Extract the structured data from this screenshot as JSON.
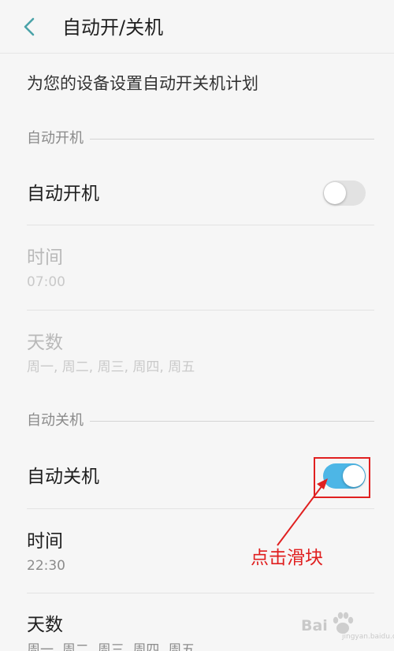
{
  "header": {
    "title": "自动开/关机"
  },
  "description": "为您的设备设置自动开关机计划",
  "power_on_section": {
    "label": "自动开机",
    "toggle": {
      "label": "自动开机",
      "enabled": false
    },
    "time": {
      "label": "时间",
      "value": "07:00"
    },
    "days": {
      "label": "天数",
      "value": "周一, 周二, 周三, 周四, 周五"
    }
  },
  "power_off_section": {
    "label": "自动关机",
    "toggle": {
      "label": "自动关机",
      "enabled": true
    },
    "time": {
      "label": "时间",
      "value": "22:30"
    },
    "days": {
      "label": "天数",
      "value": "周一, 周二, 周三, 周四, 周五"
    }
  },
  "annotation": {
    "text": "点击滑块"
  },
  "colors": {
    "accent": "#4db6e6",
    "annotation": "#e02020"
  },
  "watermark": {
    "text": "Bai",
    "sub": "jingyan.baidu.com"
  }
}
